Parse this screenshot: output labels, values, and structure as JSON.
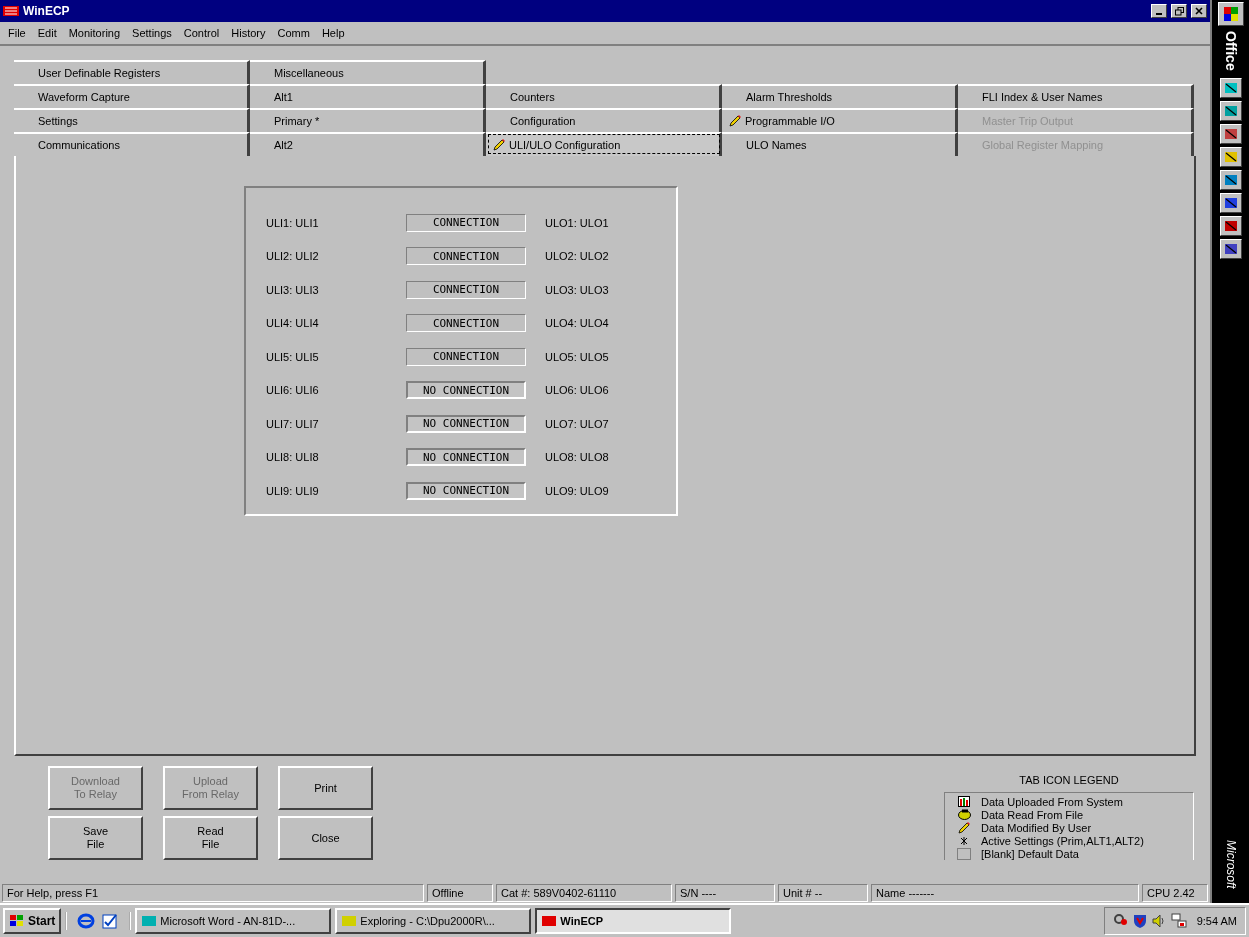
{
  "window": {
    "title": "WinECP"
  },
  "menu": [
    {
      "label": "File"
    },
    {
      "label": "Edit"
    },
    {
      "label": "Monitoring"
    },
    {
      "label": "Settings"
    },
    {
      "label": "Control"
    },
    {
      "label": "History"
    },
    {
      "label": "Comm"
    },
    {
      "label": "Help"
    }
  ],
  "tab_rows": [
    [
      {
        "label": "User Definable Registers",
        "selected": false,
        "disabled": false,
        "modified": false
      },
      {
        "label": "Miscellaneous",
        "selected": false,
        "disabled": false,
        "modified": false
      }
    ],
    [
      {
        "label": "Waveform Capture",
        "selected": false,
        "disabled": false,
        "modified": false
      },
      {
        "label": "Alt1",
        "selected": false,
        "disabled": false,
        "modified": false
      },
      {
        "label": "Counters",
        "selected": false,
        "disabled": false,
        "modified": false
      },
      {
        "label": "Alarm Thresholds",
        "selected": false,
        "disabled": false,
        "modified": false
      },
      {
        "label": "FLI Index & User Names",
        "selected": false,
        "disabled": false,
        "modified": false
      }
    ],
    [
      {
        "label": "Settings",
        "selected": false,
        "disabled": false,
        "modified": false
      },
      {
        "label": "Primary *",
        "selected": false,
        "disabled": false,
        "modified": false
      },
      {
        "label": "Configuration",
        "selected": false,
        "disabled": false,
        "modified": false
      },
      {
        "label": "Programmable I/O",
        "selected": false,
        "disabled": false,
        "modified": true
      },
      {
        "label": "Master Trip Output",
        "selected": false,
        "disabled": true,
        "modified": false
      }
    ],
    [
      {
        "label": "Communications",
        "selected": false,
        "disabled": false,
        "modified": false
      },
      {
        "label": "Alt2",
        "selected": false,
        "disabled": false,
        "modified": false
      },
      {
        "label": "ULI/ULO Configuration",
        "selected": true,
        "disabled": false,
        "modified": true
      },
      {
        "label": "ULO Names",
        "selected": false,
        "disabled": false,
        "modified": false
      },
      {
        "label": "Global Register Mapping",
        "selected": false,
        "disabled": true,
        "modified": false
      }
    ]
  ],
  "mappings": [
    {
      "input": "ULI1: ULI1",
      "status": "CONNECTION",
      "connected": true,
      "output": "ULO1: ULO1"
    },
    {
      "input": "ULI2: ULI2",
      "status": "CONNECTION",
      "connected": true,
      "output": "ULO2: ULO2"
    },
    {
      "input": "ULI3: ULI3",
      "status": "CONNECTION",
      "connected": true,
      "output": "ULO3: ULO3"
    },
    {
      "input": "ULI4: ULI4",
      "status": "CONNECTION",
      "connected": true,
      "output": "ULO4: ULO4"
    },
    {
      "input": "ULI5: ULI5",
      "status": "CONNECTION",
      "connected": true,
      "output": "ULO5: ULO5"
    },
    {
      "input": "ULI6: ULI6",
      "status": "NO CONNECTION",
      "connected": false,
      "output": "ULO6: ULO6"
    },
    {
      "input": "ULI7: ULI7",
      "status": "NO CONNECTION",
      "connected": false,
      "output": "ULO7: ULO7"
    },
    {
      "input": "ULI8: ULI8",
      "status": "NO CONNECTION",
      "connected": false,
      "output": "ULO8: ULO8"
    },
    {
      "input": "ULI9: ULI9",
      "status": "NO CONNECTION",
      "connected": false,
      "output": "ULO9: ULO9"
    }
  ],
  "buttons": [
    {
      "label": "Download\nTo Relay",
      "disabled": true
    },
    {
      "label": "Upload\nFrom Relay",
      "disabled": true
    },
    {
      "label": "Print",
      "disabled": false
    },
    {
      "label": "Save\nFile",
      "disabled": false
    },
    {
      "label": "Read\nFile",
      "disabled": false
    },
    {
      "label": "Close",
      "disabled": false
    }
  ],
  "legend": {
    "title": "TAB ICON LEGEND",
    "items": [
      {
        "kind": "uploaded",
        "label": "Data Uploaded From System"
      },
      {
        "kind": "read",
        "label": "Data Read From File"
      },
      {
        "kind": "modified",
        "label": "Data Modified By User"
      },
      {
        "kind": "active",
        "label": "Active Settings (Prim,ALT1,ALT2)"
      },
      {
        "kind": "blank",
        "label": "[Blank] Default Data"
      }
    ]
  },
  "status_bar": [
    "For Help, press F1",
    "Offline",
    "Cat #: 589V0402-61110",
    "S/N  ----",
    "Unit #  --",
    "Name  -------",
    "CPU  2.42"
  ],
  "office_bar": {
    "title": "Office",
    "footer": "Microsoft"
  },
  "taskbar": {
    "start": "Start",
    "tasks": [
      {
        "label": "Microsoft Word - AN-81D-...",
        "selected": false
      },
      {
        "label": "Exploring - C:\\Dpu2000R\\...",
        "selected": false
      },
      {
        "label": "WinECP",
        "selected": true
      }
    ],
    "clock": "9:54 AM"
  }
}
